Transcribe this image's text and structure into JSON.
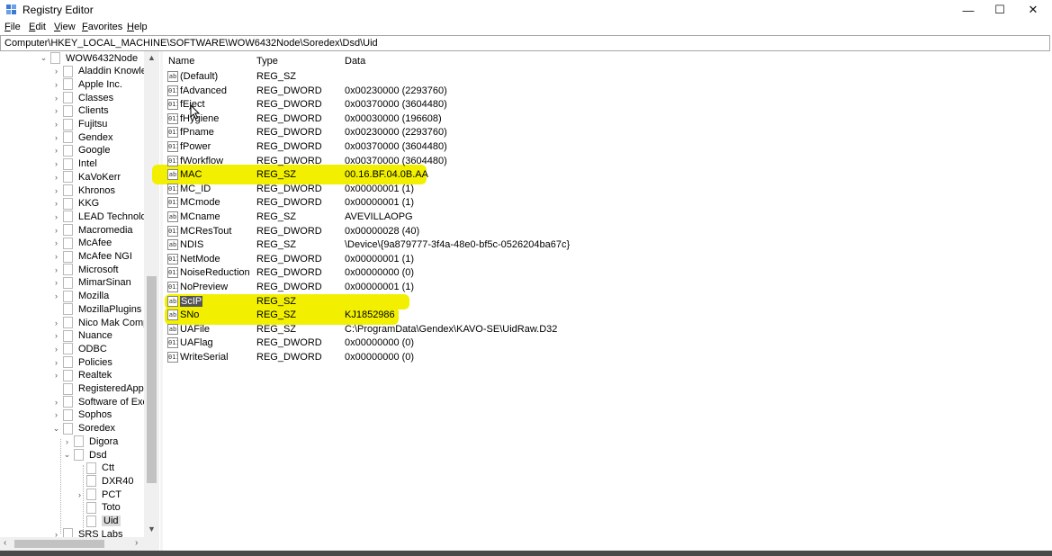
{
  "window": {
    "title": "Registry Editor",
    "minimize": "—",
    "maximize": "☐",
    "close": "✕"
  },
  "menu": [
    {
      "label": "File",
      "underline": "F",
      "rest": "ile"
    },
    {
      "label": "Edit",
      "underline": "E",
      "rest": "dit"
    },
    {
      "label": "View",
      "underline": "V",
      "rest": "iew"
    },
    {
      "label": "Favorites",
      "underline": "F",
      "rest": "avorites"
    },
    {
      "label": "Help",
      "underline": "H",
      "rest": "elp"
    }
  ],
  "address": "Computer\\HKEY_LOCAL_MACHINE\\SOFTWARE\\WOW6432Node\\Soredex\\Dsd\\Uid",
  "tree": [
    {
      "label": "WOW6432Node",
      "level": 0,
      "expander": "v"
    },
    {
      "label": "Aladdin Knowled",
      "level": 1,
      "expander": ">"
    },
    {
      "label": "Apple Inc.",
      "level": 1,
      "expander": ">"
    },
    {
      "label": "Classes",
      "level": 1,
      "expander": ">"
    },
    {
      "label": "Clients",
      "level": 1,
      "expander": ">"
    },
    {
      "label": "Fujitsu",
      "level": 1,
      "expander": ">"
    },
    {
      "label": "Gendex",
      "level": 1,
      "expander": ">"
    },
    {
      "label": "Google",
      "level": 1,
      "expander": ">"
    },
    {
      "label": "Intel",
      "level": 1,
      "expander": ">"
    },
    {
      "label": "KaVoKerr",
      "level": 1,
      "expander": ">"
    },
    {
      "label": "Khronos",
      "level": 1,
      "expander": ">"
    },
    {
      "label": "KKG",
      "level": 1,
      "expander": ">"
    },
    {
      "label": "LEAD Technologi",
      "level": 1,
      "expander": ">"
    },
    {
      "label": "Macromedia",
      "level": 1,
      "expander": ">"
    },
    {
      "label": "McAfee",
      "level": 1,
      "expander": ">"
    },
    {
      "label": "McAfee NGI",
      "level": 1,
      "expander": ">"
    },
    {
      "label": "Microsoft",
      "level": 1,
      "expander": ">"
    },
    {
      "label": "MimarSinan",
      "level": 1,
      "expander": ">"
    },
    {
      "label": "Mozilla",
      "level": 1,
      "expander": ">"
    },
    {
      "label": "MozillaPlugins",
      "level": 1,
      "expander": ""
    },
    {
      "label": "Nico Mak Compu",
      "level": 1,
      "expander": ">"
    },
    {
      "label": "Nuance",
      "level": 1,
      "expander": ">"
    },
    {
      "label": "ODBC",
      "level": 1,
      "expander": ">"
    },
    {
      "label": "Policies",
      "level": 1,
      "expander": ">"
    },
    {
      "label": "Realtek",
      "level": 1,
      "expander": ">"
    },
    {
      "label": "RegisteredApplica",
      "level": 1,
      "expander": ""
    },
    {
      "label": "Software of Excell",
      "level": 1,
      "expander": ">"
    },
    {
      "label": "Sophos",
      "level": 1,
      "expander": ">"
    },
    {
      "label": "Soredex",
      "level": 1,
      "expander": "v"
    },
    {
      "label": "Digora",
      "level": 2,
      "expander": ">"
    },
    {
      "label": "Dsd",
      "level": 2,
      "expander": "v"
    },
    {
      "label": "Ctt",
      "level": 3,
      "expander": ""
    },
    {
      "label": "DXR40",
      "level": 3,
      "expander": ""
    },
    {
      "label": "PCT",
      "level": 3,
      "expander": ">"
    },
    {
      "label": "Toto",
      "level": 3,
      "expander": ""
    },
    {
      "label": "Uid",
      "level": 3,
      "expander": "",
      "selected": true
    },
    {
      "label": "SRS Labs",
      "level": 1,
      "expander": ">"
    }
  ],
  "columns": {
    "name": "Name",
    "type": "Type",
    "data": "Data"
  },
  "values": [
    {
      "name": "(Default)",
      "type": "REG_SZ",
      "data": "",
      "icon": "ab"
    },
    {
      "name": "fAdvanced",
      "type": "REG_DWORD",
      "data": "0x00230000 (2293760)",
      "icon": "011"
    },
    {
      "name": "fEject",
      "type": "REG_DWORD",
      "data": "0x00370000 (3604480)",
      "icon": "011"
    },
    {
      "name": "fHygiene",
      "type": "REG_DWORD",
      "data": "0x00030000 (196608)",
      "icon": "011"
    },
    {
      "name": "fPname",
      "type": "REG_DWORD",
      "data": "0x00230000 (2293760)",
      "icon": "011"
    },
    {
      "name": "fPower",
      "type": "REG_DWORD",
      "data": "0x00370000 (3604480)",
      "icon": "011"
    },
    {
      "name": "fWorkflow",
      "type": "REG_DWORD",
      "data": "0x00370000 (3604480)",
      "icon": "011"
    },
    {
      "name": "MAC",
      "type": "REG_SZ",
      "data": "00.16.BF.04.0B.AA",
      "icon": "ab"
    },
    {
      "name": "MC_ID",
      "type": "REG_DWORD",
      "data": "0x00000001 (1)",
      "icon": "011"
    },
    {
      "name": "MCmode",
      "type": "REG_DWORD",
      "data": "0x00000001 (1)",
      "icon": "011"
    },
    {
      "name": "MCname",
      "type": "REG_SZ",
      "data": "AVEVILLAOPG",
      "icon": "ab"
    },
    {
      "name": "MCResTout",
      "type": "REG_DWORD",
      "data": "0x00000028 (40)",
      "icon": "011"
    },
    {
      "name": "NDIS",
      "type": "REG_SZ",
      "data": "\\Device\\{9a879777-3f4a-48e0-bf5c-0526204ba67c}",
      "icon": "ab"
    },
    {
      "name": "NetMode",
      "type": "REG_DWORD",
      "data": "0x00000001 (1)",
      "icon": "011"
    },
    {
      "name": "NoiseReduction",
      "type": "REG_DWORD",
      "data": "0x00000000 (0)",
      "icon": "011"
    },
    {
      "name": "NoPreview",
      "type": "REG_DWORD",
      "data": "0x00000001 (1)",
      "icon": "011"
    },
    {
      "name": "ScIP",
      "type": "REG_SZ",
      "data": "",
      "icon": "ab",
      "selected": true
    },
    {
      "name": "SNo",
      "type": "REG_SZ",
      "data": "KJ1852986",
      "icon": "ab"
    },
    {
      "name": "UAFile",
      "type": "REG_SZ",
      "data": "C:\\ProgramData\\Gendex\\KAVO-SE\\UidRaw.D32",
      "icon": "ab"
    },
    {
      "name": "UAFlag",
      "type": "REG_DWORD",
      "data": "0x00000000 (0)",
      "icon": "011"
    },
    {
      "name": "WriteSerial",
      "type": "REG_DWORD",
      "data": "0x00000000 (0)",
      "icon": "011"
    }
  ],
  "highlight_color": "#f2f000"
}
